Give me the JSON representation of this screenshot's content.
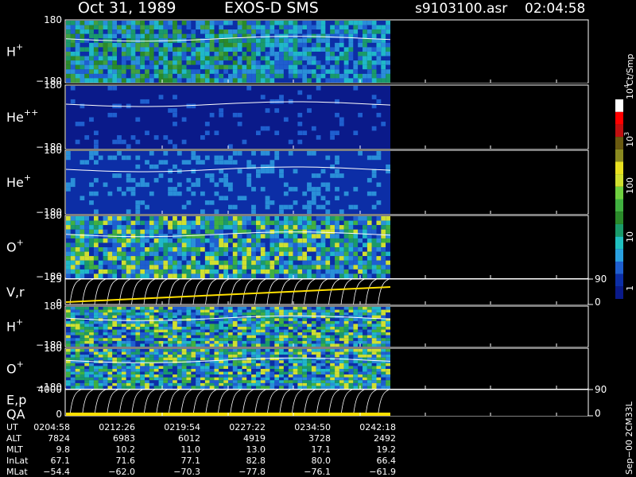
{
  "header": {
    "date": "Oct 31, 1989",
    "mission": "EXOS-D SMS",
    "file": "s9103100.asr",
    "time": "02:04:58"
  },
  "colorbar": {
    "label": "Ct/Smp",
    "ticks": [
      {
        "label": "1"
      },
      {
        "label": "10"
      },
      {
        "label": "100"
      },
      {
        "label": "10",
        "sup": "3"
      },
      {
        "label": "10",
        "sup": "4"
      }
    ],
    "colors": [
      "#0a1a8a",
      "#0c2ea6",
      "#1f5fcf",
      "#2aa0e0",
      "#20c0c0",
      "#1a9a6a",
      "#2a8a2a",
      "#40b040",
      "#70d040",
      "#d0e030",
      "#e8e020",
      "#8a8a20",
      "#6a5a10",
      "#c01010",
      "#ff0000",
      "#ffffff"
    ]
  },
  "panels": [
    {
      "species": "H",
      "charge": "+",
      "ymax": "180",
      "ymin": "−180",
      "style": "ion"
    },
    {
      "species": "He",
      "charge": "++",
      "ymax": "180",
      "ymin": "−180",
      "style": "ion"
    },
    {
      "species": "He",
      "charge": "+",
      "ymax": "180",
      "ymin": "−180",
      "style": "ion"
    },
    {
      "species": "O",
      "charge": "+",
      "ymax": "180",
      "ymin": "−180",
      "style": "ion"
    },
    {
      "species": "V,r",
      "charge": "",
      "ymax": "25",
      "ymin": "0",
      "right_top": "90",
      "right_bottom": "0",
      "style": "curves"
    },
    {
      "species": "H",
      "charge": "+",
      "ymax": "180",
      "ymin": "−180",
      "style": "ion"
    },
    {
      "species": "O",
      "charge": "+",
      "ymax": "180",
      "ymin": "−180",
      "style": "ion"
    },
    {
      "species": "E,p",
      "charge": "",
      "species2": "QA",
      "ymax": "4000",
      "ymin": "0",
      "right_top": "90",
      "right_bottom": "0",
      "style": "curves"
    }
  ],
  "footer": {
    "row_labels": [
      "UT",
      "ALT",
      "MLT",
      "InLat",
      "MLat"
    ],
    "columns": [
      [
        "0204:58",
        "7824",
        "9.8",
        "67.1",
        "−54.4"
      ],
      [
        "0212:26",
        "6983",
        "10.2",
        "71.6",
        "−62.0"
      ],
      [
        "0219:54",
        "6012",
        "11.0",
        "77.1",
        "−70.3"
      ],
      [
        "0227:22",
        "4919",
        "13.0",
        "82.8",
        "−77.8"
      ],
      [
        "0234:50",
        "3728",
        "17.1",
        "80.0",
        "−76.1"
      ],
      [
        "0242:18",
        "2492",
        "19.2",
        "66.4",
        "−61.9"
      ]
    ]
  },
  "side_note": "Sep−00 2CM33L",
  "chart_data": {
    "type": "heatmap",
    "x_ticks_ut": [
      "0204:58",
      "0212:26",
      "0219:54",
      "0227:22",
      "0234:50",
      "0242:18"
    ],
    "colorbar_range": [
      1,
      10000
    ],
    "colorbar_scale": "log",
    "series": [
      {
        "name": "H+",
        "ylim": [
          -180,
          180
        ]
      },
      {
        "name": "He++",
        "ylim": [
          -180,
          180
        ]
      },
      {
        "name": "He+",
        "ylim": [
          -180,
          180
        ]
      },
      {
        "name": "O+",
        "ylim": [
          -180,
          180
        ]
      },
      {
        "name": "V,r",
        "ylim": [
          0,
          25
        ]
      },
      {
        "name": "H+",
        "ylim": [
          -180,
          180
        ]
      },
      {
        "name": "O+",
        "ylim": [
          -180,
          180
        ]
      },
      {
        "name": "E,p",
        "ylim": [
          0,
          4000
        ]
      }
    ]
  }
}
